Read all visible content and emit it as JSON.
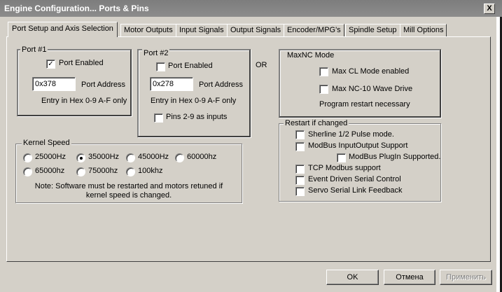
{
  "window": {
    "title": "Engine Configuration... Ports & Pins",
    "close_glyph": "X"
  },
  "tabs": [
    {
      "label": "Port Setup and Axis Selection",
      "active": true
    },
    {
      "label": "Motor Outputs"
    },
    {
      "label": "Input Signals"
    },
    {
      "label": "Output Signals"
    },
    {
      "label": "Encoder/MPG's"
    },
    {
      "label": "Spindle Setup"
    },
    {
      "label": "Mill Options"
    }
  ],
  "port1": {
    "title": "Port #1",
    "enabled_label": "Port Enabled",
    "enabled": true,
    "check_glyph": "✓",
    "address_value": "0x378",
    "address_label": "Port Address",
    "hint": "Entry in Hex 0-9 A-F only"
  },
  "port2": {
    "title": "Port #2",
    "enabled_label": "Port Enabled",
    "enabled": false,
    "address_value": "0x278",
    "address_label": "Port Address",
    "hint": "Entry in Hex 0-9 A-F only",
    "pins_label": "Pins 2-9 as inputs",
    "pins_checked": false
  },
  "or_label": "OR",
  "maxnc": {
    "title": "MaxNC Mode",
    "cl_label": "Max CL Mode enabled",
    "wave_label": "Max NC-10 Wave Drive",
    "note": "Program restart necessary"
  },
  "kernel": {
    "title": "Kernel Speed",
    "options": [
      "25000Hz",
      "35000Hz",
      "45000Hz",
      "60000hz",
      "65000hz",
      "75000hz",
      "100khz"
    ],
    "selected": "35000Hz",
    "note_line1": "Note: Software must be restarted and motors retuned if",
    "note_line2": "kernel speed is changed."
  },
  "restart": {
    "title": "Restart if changed",
    "items": [
      "Sherline 1/2 Pulse mode.",
      "ModBus InputOutput Support",
      "ModBus PlugIn Supported.",
      "TCP Modbus support",
      "Event Driven Serial Control",
      "Servo Serial Link Feedback"
    ]
  },
  "buttons": {
    "ok": "OK",
    "cancel": "Отмена",
    "apply": "Применить"
  }
}
